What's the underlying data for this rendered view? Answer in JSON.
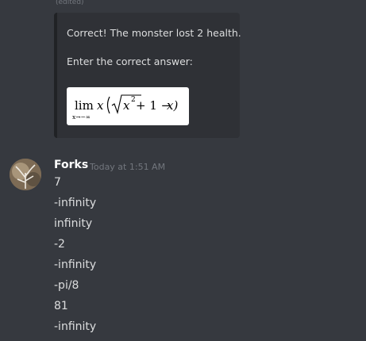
{
  "previous_message": {
    "edited_label": "(edited)",
    "embed": {
      "line1": "Correct! The monster lost 2 health.",
      "line2": "Enter the correct answer:",
      "formula": {
        "lim": "lim",
        "subscript": "x→−∞",
        "x": "x",
        "exponent": "2",
        "plus_one": "+ 1 −",
        "x_close": "x)"
      }
    }
  },
  "message_group": {
    "author": "Forks",
    "timestamp": "Today at 1:51 AM",
    "messages": [
      "7",
      "-infinity",
      "infinity",
      "-2",
      "-infinity",
      "-pi/8",
      "81",
      "-infinity"
    ]
  }
}
